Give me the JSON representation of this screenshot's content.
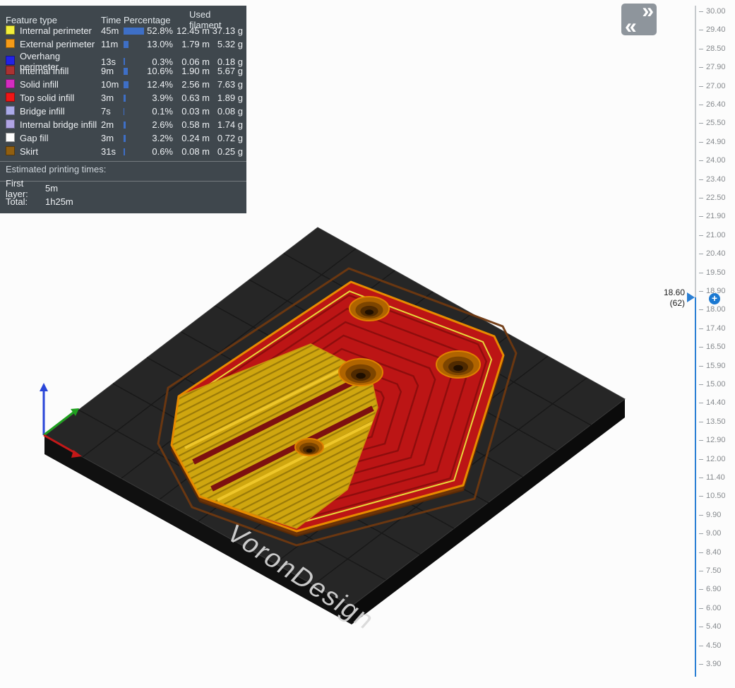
{
  "legend": {
    "headers": {
      "feature_type": "Feature type",
      "time": "Time",
      "percentage": "Percentage",
      "used_filament": "Used filament"
    },
    "rows": [
      {
        "label": "Internal perimeter",
        "color": "#f2ee3a",
        "time": "45m",
        "bar": 29,
        "percent": "52.8%",
        "length": "12.45 m",
        "weight": "37.13 g"
      },
      {
        "label": "External perimeter",
        "color": "#f59b18",
        "time": "11m",
        "bar": 7,
        "percent": "13.0%",
        "length": "1.79 m",
        "weight": "5.32 g"
      },
      {
        "label": "Overhang perimeter",
        "color": "#2222e6",
        "time": "13s",
        "bar": 2,
        "percent": "0.3%",
        "length": "0.06 m",
        "weight": "0.18 g"
      },
      {
        "label": "Internal infill",
        "color": "#ab3232",
        "time": "9m",
        "bar": 6,
        "percent": "10.6%",
        "length": "1.90 m",
        "weight": "5.67 g"
      },
      {
        "label": "Solid infill",
        "color": "#d42cc0",
        "time": "10m",
        "bar": 7,
        "percent": "12.4%",
        "length": "2.56 m",
        "weight": "7.63 g"
      },
      {
        "label": "Top solid infill",
        "color": "#f01616",
        "time": "3m",
        "bar": 3,
        "percent": "3.9%",
        "length": "0.63 m",
        "weight": "1.89 g"
      },
      {
        "label": "Bridge infill",
        "color": "#aaaae8",
        "time": "7s",
        "bar": 1,
        "percent": "0.1%",
        "length": "0.03 m",
        "weight": "0.08 g"
      },
      {
        "label": "Internal bridge infill",
        "color": "#b0a4e4",
        "time": "2m",
        "bar": 3,
        "percent": "2.6%",
        "length": "0.58 m",
        "weight": "1.74 g"
      },
      {
        "label": "Gap fill",
        "color": "#ffffff",
        "time": "3m",
        "bar": 3,
        "percent": "3.2%",
        "length": "0.24 m",
        "weight": "0.72 g"
      },
      {
        "label": "Skirt",
        "color": "#915f10",
        "time": "31s",
        "bar": 2,
        "percent": "0.6%",
        "length": "0.08 m",
        "weight": "0.25 g"
      }
    ],
    "estimated_title": "Estimated printing times:",
    "first_layer_label": "First layer:",
    "first_layer_value": "5m",
    "total_label": "Total:",
    "total_value": "1h25m"
  },
  "viewport": {
    "bed_text": "VoronDesign"
  },
  "toolbar": {
    "expand_icon": "»",
    "collapse_icon": "«"
  },
  "slider": {
    "tick_labels": [
      "30.00",
      "29.40",
      "28.50",
      "27.90",
      "27.00",
      "26.40",
      "25.50",
      "24.90",
      "24.00",
      "23.40",
      "22.50",
      "21.90",
      "21.00",
      "20.40",
      "19.50",
      "18.90",
      "18.00",
      "17.40",
      "16.50",
      "15.90",
      "15.00",
      "14.40",
      "13.50",
      "12.90",
      "12.00",
      "11.40",
      "10.50",
      "9.90",
      "9.00",
      "8.40",
      "7.50",
      "6.90",
      "6.00",
      "5.40",
      "4.50",
      "3.90"
    ],
    "current_value": "18.60",
    "current_layer": "(62)",
    "accent": "#2a7fd4"
  }
}
